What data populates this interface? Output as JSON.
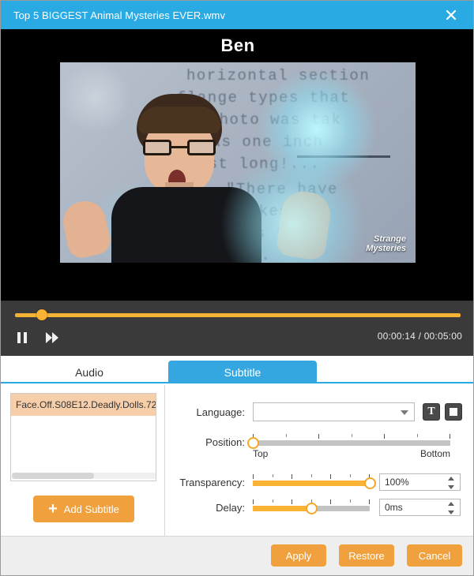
{
  "titlebar": {
    "title": "Top 5 BIGGEST Animal Mysteries EVER.wmv",
    "close_icon": "close-icon",
    "bg_color": "#29aae3"
  },
  "player": {
    "video_title": "Ben",
    "watermark_line1": "Strange",
    "watermark_line2": "Mysteries",
    "background_text": [
      "horizontal section",
      "flange types that",
      "is photo was tak",
      "ing as one inch",
      "o fast long!...",
      "\"There have",
      "s sakes,",
      "forms that",
      "nor..."
    ],
    "seek": {
      "value_percent": 4.7,
      "fill_color": "#f5b335",
      "handle_color": "#f9b233"
    },
    "pause_button_label": "Pause",
    "forward_button_label": "Fast Forward",
    "current_time": "00:00:14",
    "total_time": "00:05:00",
    "time_separator": "/"
  },
  "tabs": [
    {
      "label": "Audio",
      "active": false
    },
    {
      "label": "Subtitle",
      "active": true
    }
  ],
  "subtitle_panel": {
    "list_items": [
      {
        "label": "Face.Off.S08E12.Deadly.Dolls.72",
        "selected": true
      }
    ],
    "add_button_label": "Add Subtitle",
    "add_button_icon": "plus-icon",
    "language": {
      "label": "Language:",
      "value": "",
      "placeholder": ""
    },
    "font_button_icon": "text-font-icon",
    "color_button_icon": "color-square-icon",
    "position": {
      "label": "Position:",
      "value_percent": 0,
      "min_label": "Top",
      "max_label": "Bottom",
      "ticks": 7
    },
    "transparency": {
      "label": "Transparency:",
      "value_percent": 100,
      "display_value": "100%",
      "ticks": 7
    },
    "delay": {
      "label": "Delay:",
      "value_percent": 50,
      "display_value": "0ms",
      "ticks": 7
    }
  },
  "footer": {
    "apply_label": "Apply",
    "restore_label": "Restore",
    "cancel_label": "Cancel",
    "button_color": "#f0a03c"
  }
}
